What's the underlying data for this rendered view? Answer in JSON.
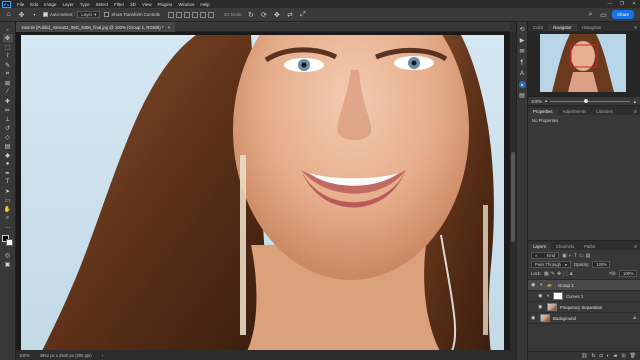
{
  "app": {
    "logo": "Ps"
  },
  "menu": [
    "File",
    "Edit",
    "Image",
    "Layer",
    "Type",
    "Select",
    "Filter",
    "3D",
    "View",
    "Plugins",
    "Window",
    "Help"
  ],
  "window_controls": [
    "—",
    "❐",
    "✕"
  ],
  "options": {
    "auto_select_label": "Auto-Select:",
    "auto_select_target": "Layer",
    "transform_controls_label": "Show Transform Controls",
    "mode_label": "3D Mode:",
    "share_label": "Share"
  },
  "document": {
    "tab_title": "Yasmin [Public]_Alena02_IMG_8486_final.jpg @ 100% (Group 1, RGB/8) *",
    "close_glyph": "×"
  },
  "status": {
    "zoom": "100%",
    "info": "3952 px x 2640 px (300 ppi)",
    "arrow": "›"
  },
  "navigator": {
    "tabs": [
      "Color",
      "Navigator",
      "Histogram"
    ],
    "active_tab": 1,
    "zoom": "100%",
    "zoom_level": 0.42
  },
  "properties": {
    "tabs": [
      "Properties",
      "Adjustments",
      "Libraries"
    ],
    "active_tab": 0,
    "content": "No Properties"
  },
  "layers": {
    "tabs": [
      "Layers",
      "Channels",
      "Paths"
    ],
    "active_tab": 0,
    "filter_kind": "Kind",
    "blend_mode": "Pass Through",
    "opacity_label": "Opacity:",
    "opacity_value": "100%",
    "lock_label": "Lock:",
    "fill_label": "Fill:",
    "fill_value": "100%",
    "items": [
      {
        "name": "Group 1",
        "type": "group"
      },
      {
        "name": "Curves 1",
        "type": "adjustment"
      },
      {
        "name": "Frequency Separation",
        "type": "image"
      },
      {
        "name": "Background",
        "type": "background"
      }
    ]
  },
  "colors": {
    "accent": "#1473e6",
    "sky": "#cfe3ef",
    "skin": "#e8b493",
    "hair": "#6a3a1e"
  }
}
